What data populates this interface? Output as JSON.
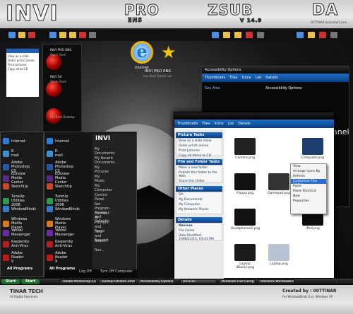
{
  "banner": {
    "invi": "INVI",
    "pro": "PRO",
    "ens": "ENS",
    "zsub": "ZSUB",
    "version": "V 14.9",
    "da": "DA",
    "da_sub": "007TiNAR.deviantart.com"
  },
  "desktop": {
    "ie_label": "Internet",
    "orb1_title": "INVI PRO ENS",
    "orb1_sub": "Black Shell",
    "orb2_title": "INVI 5X",
    "orb2_sub": "White Shell",
    "dark_desktop_label": "For Dark Desktop",
    "center_title": "INVI PRO ENS",
    "center_sub": "Invi Shell Darker ver"
  },
  "start_menu_left": {
    "items": [
      {
        "label": "Internet",
        "sub": "Internet Explorer",
        "color": "#2b7fd8"
      },
      {
        "label": "E-mail",
        "sub": "Outlook Express",
        "color": "#3e8ed0"
      },
      {
        "label": "Adobe Photoshop CS",
        "color": "#2857a4"
      },
      {
        "label": "EDiview Media Center",
        "color": "#5a2a8a"
      },
      {
        "label": "SketchUp",
        "color": "#c24a2a"
      },
      {
        "label": "TuneUp Utilities 2008",
        "color": "#2f9a4e"
      },
      {
        "label": "WindowBlinds",
        "color": "#3a79c8"
      },
      {
        "label": "Windows Media Player",
        "color": "#d77a1f"
      },
      {
        "label": "Yahoo! Messenger",
        "color": "#6a2ca0"
      },
      {
        "label": "Kaspersky Anti-Virus",
        "color": "#b31f1f"
      },
      {
        "label": "Adobe Reader 9",
        "color": "#c01818"
      }
    ],
    "all_programs": "All Programs"
  },
  "start_menu_right": {
    "items": [
      "My Documents",
      "My Recent Documents",
      "My Pictures",
      "My Music",
      "My Computer",
      "Control Panel",
      "Set Program Access and Defaults",
      "Connect To",
      "Printers and Faxes",
      "Help and Support",
      "Search",
      "Run..."
    ],
    "log_off": "Log Off",
    "turn_off": "Turn Off Computer"
  },
  "explorer": {
    "tabs": [
      "Thumbnails",
      "Tiles",
      "Icons",
      "List",
      "Details"
    ],
    "picture_tasks_header": "Picture Tasks",
    "picture_tasks": [
      "View as a slide show",
      "Order prints online",
      "Print pictures",
      "Copy all items to CD"
    ],
    "file_tasks_header": "File and Folder Tasks",
    "file_tasks": [
      "Make a new folder",
      "Publish this folder to the Web",
      "Share this folder"
    ],
    "other_places_header": "Other Places",
    "other_places": [
      "DA",
      "My Documents",
      "My Computer",
      "My Network Places"
    ],
    "details_header": "Details",
    "details": [
      "Devices",
      "File Folder",
      "Date Modified: 2008/12/15, 03:43 PM"
    ],
    "files": [
      {
        "label": "Camera.png",
        "color": "#222"
      },
      {
        "label": "Computer.png",
        "color": "#1d3e6e"
      },
      {
        "label": "Floppy.png",
        "color": "#111"
      },
      {
        "label": "Gamepad.png",
        "color": "#333"
      },
      {
        "label": "Headphones2.png",
        "color": "#111"
      },
      {
        "label": "iPod.png",
        "color": "#0c0c0c"
      },
      {
        "label": "Laptop (Black).png",
        "color": "#1a1a1a"
      },
      {
        "label": "Laptop.png",
        "color": "#b8c4d4"
      }
    ]
  },
  "context_menu": {
    "items": [
      "View",
      "Arrange Icons By",
      "Refresh",
      "Customize This Folder...",
      "Paste",
      "Paste Shortcut",
      "New",
      "Properties"
    ],
    "selected_index": 3
  },
  "accessibility": {
    "title": "Accessibility Options",
    "tabs": [
      "Thumbnails",
      "Tiles",
      "Icons",
      "List",
      "Details"
    ],
    "see_also": "See Also",
    "heading": "Accessibility Options",
    "panel_text": "anel"
  },
  "taskbar": {
    "start": "Start",
    "items": [
      "Adobe Photoshop CS",
      "TuneUp Utilities 2008",
      "Accessibility Options",
      "Devices",
      "Windows Live Going",
      "Stardock WindowBlinds"
    ],
    "labels_under": [
      "Floating",
      "Highlighted"
    ]
  },
  "footer": {
    "company": "TiNAR TECH",
    "rights": "All Rights Reserved.",
    "created": "Created by : 007TiNAR",
    "created_sub": "For WindowBlinds 6.x | Windows XP"
  }
}
